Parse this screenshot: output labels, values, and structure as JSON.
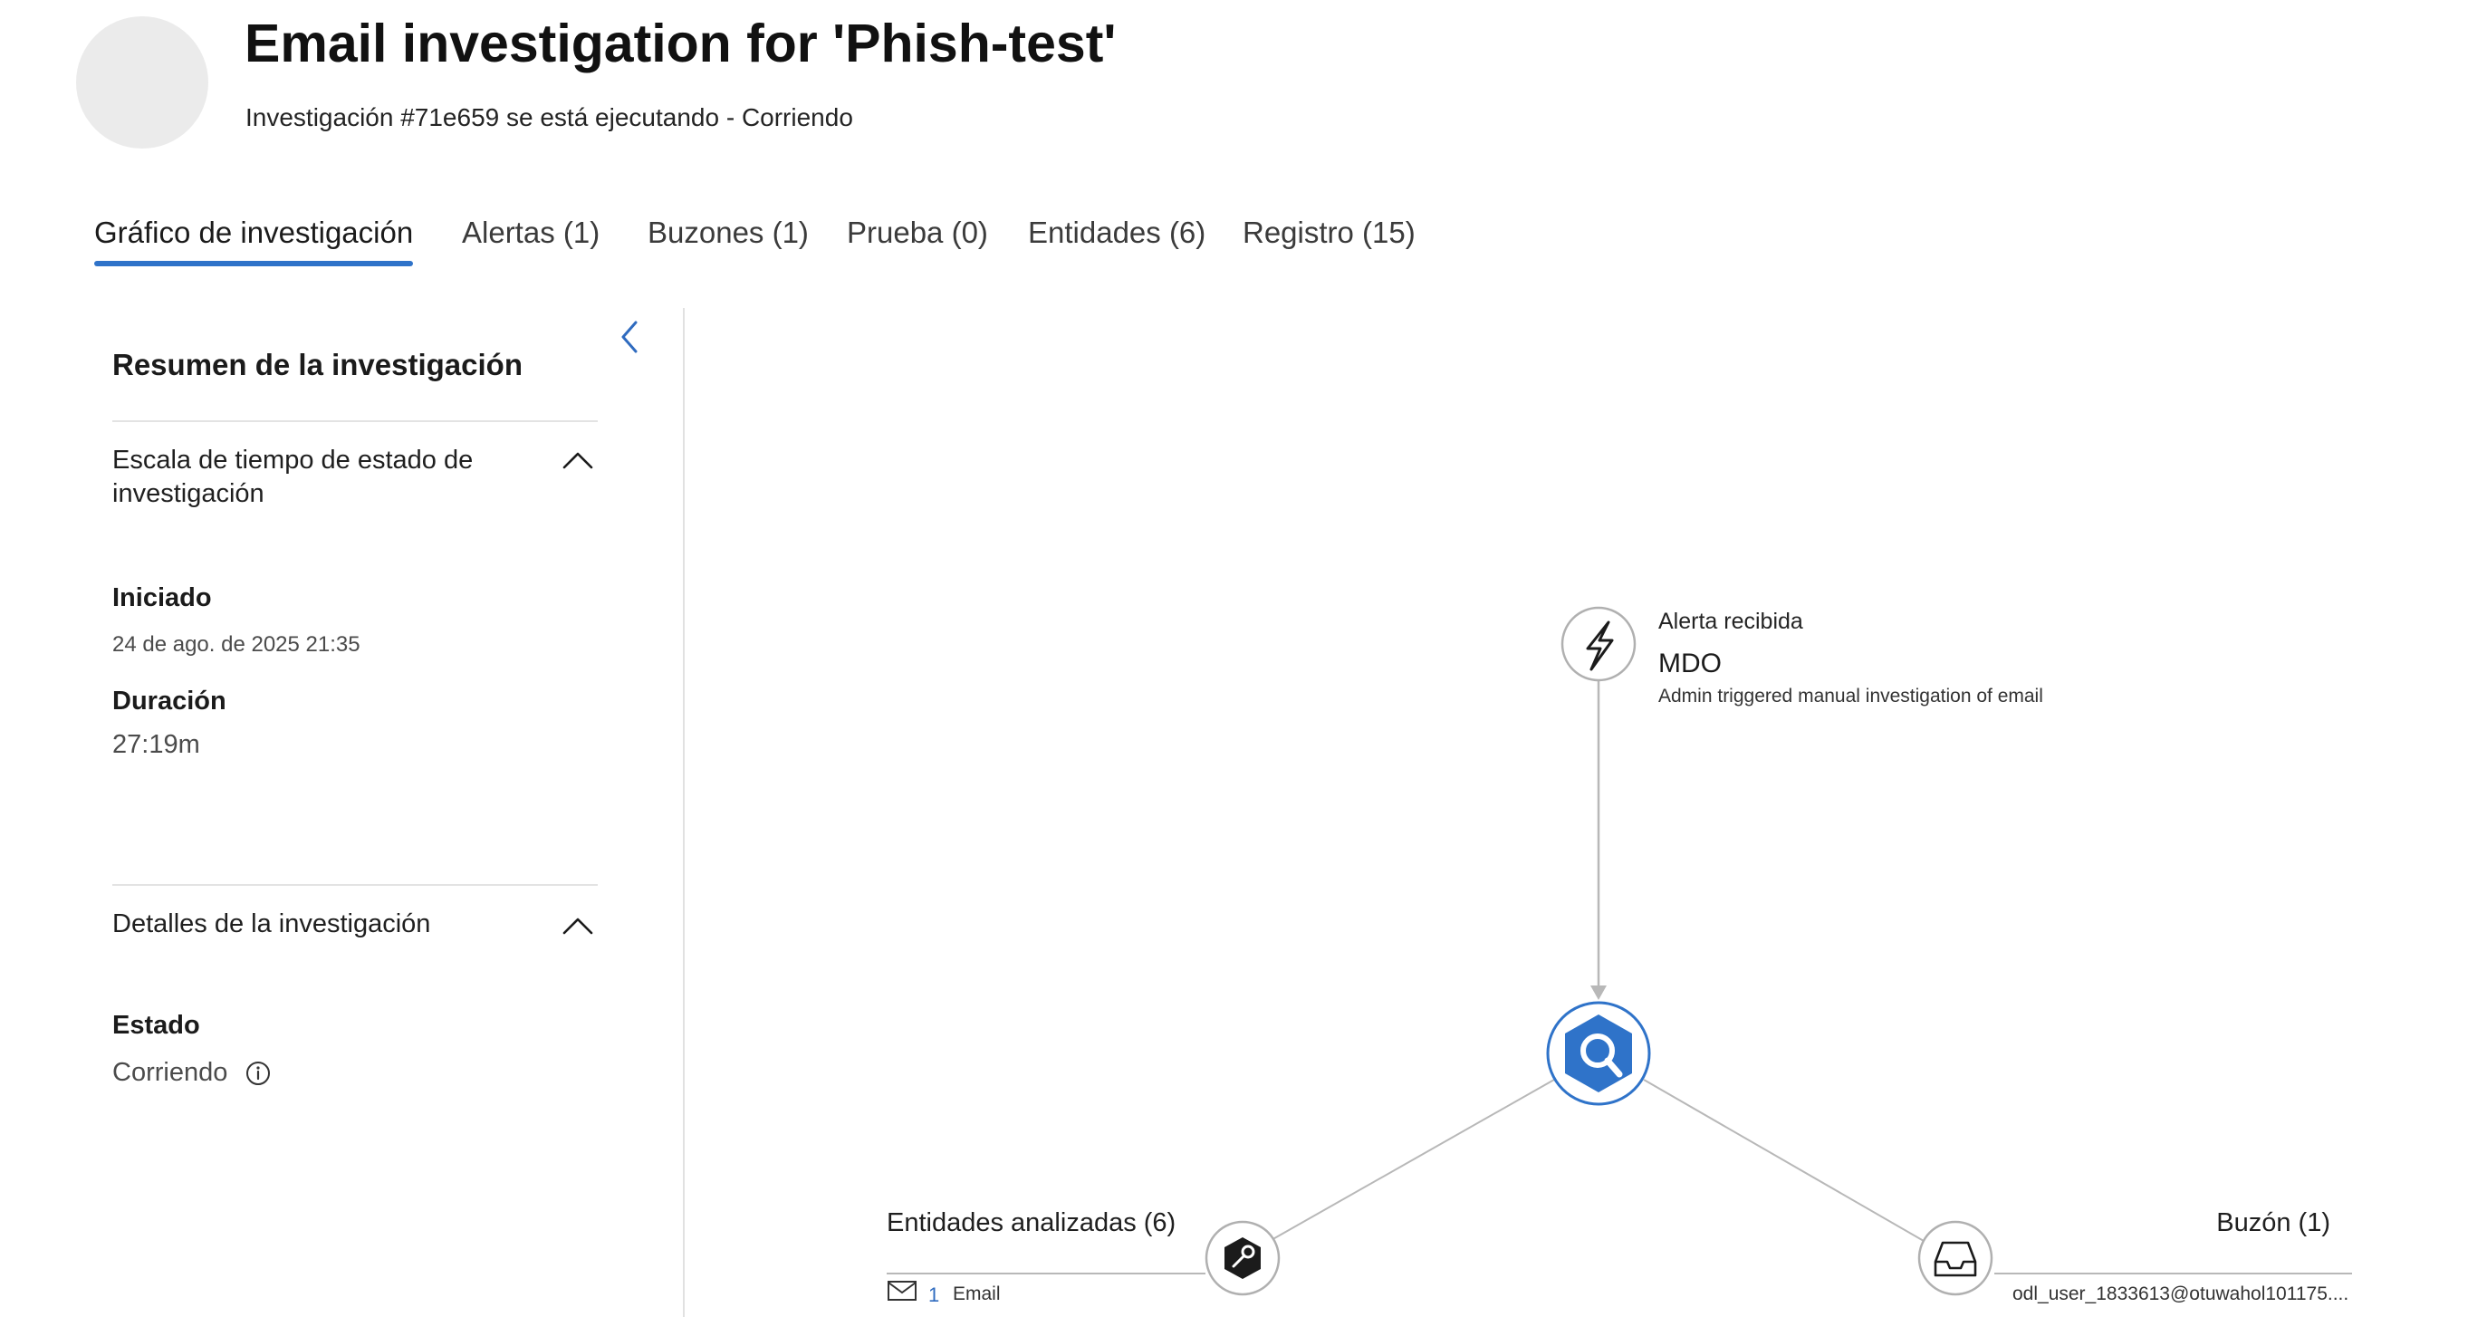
{
  "header": {
    "title": "Email investigation for 'Phish-test'",
    "subtitle": "Investigación #71e659 se está ejecutando - Corriendo"
  },
  "tabs": [
    {
      "label": "Gráfico de investigación",
      "active": true
    },
    {
      "label": "Alertas (1)",
      "active": false
    },
    {
      "label": "Buzones (1)",
      "active": false
    },
    {
      "label": "Prueba (0)",
      "active": false
    },
    {
      "label": "Entidades (6)",
      "active": false
    },
    {
      "label": "Registro (15)",
      "active": false
    }
  ],
  "summary": {
    "title": "Resumen de la investigación",
    "collapse_icon": "chevron-left-icon",
    "timeline_section": {
      "heading": "Escala de tiempo de estado de investigación",
      "started_label": "Iniciado",
      "started_value": "24 de ago. de 2025 21:35",
      "duration_label": "Duración",
      "duration_value": "27:19m"
    },
    "details_section": {
      "heading": "Detalles de la investigación",
      "status_label": "Estado",
      "status_value": "Corriendo"
    }
  },
  "graph": {
    "alert_node": {
      "icon": "lightning-icon",
      "kind": "Alerta recibida",
      "source": "MDO",
      "description": "Admin triggered manual investigation of email"
    },
    "center_node": {
      "icon": "investigation-hexagon-icon"
    },
    "entities_node": {
      "icon": "entity-hexagon-icon",
      "label": "Entidades analizadas (6)",
      "count": "1",
      "type": "Email"
    },
    "mailbox_node": {
      "icon": "inbox-icon",
      "label": "Buzón (1)",
      "address": "odl_user_1833613@otuwahol101175...."
    }
  },
  "colors": {
    "accent": "#2f73c9",
    "line": "#b8b8b8",
    "avatar": "#ebebeb"
  }
}
